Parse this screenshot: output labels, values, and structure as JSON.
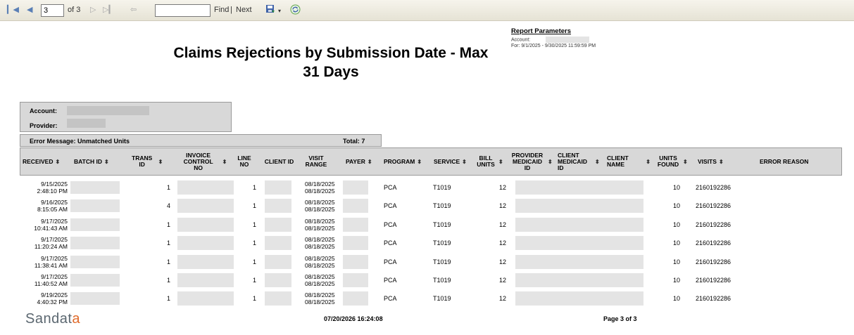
{
  "toolbar": {
    "page_value": "3",
    "of_pages": "of 3",
    "find_label": "Find",
    "separator": "|",
    "next_label": "Next",
    "icons": [
      "first-page-icon",
      "previous-page-icon",
      "next-page-icon",
      "last-page-icon",
      "back-icon",
      "export-icon",
      "dropdown-arrow-icon",
      "refresh-icon"
    ]
  },
  "report": {
    "title_line1": "Claims Rejections by Submission Date - Max",
    "title_line2": "31 Days"
  },
  "parameters": {
    "header": "Report Parameters",
    "account_label": "Account:",
    "for_text": "For: 9/1/2025 - 9/30/2025 11:59:59 PM"
  },
  "account_box": {
    "account_label": "Account:",
    "provider_label": "Provider:"
  },
  "error_group": {
    "message": "Error Message:  Unmatched Units",
    "total": "Total: 7"
  },
  "columns": [
    {
      "label": "RECEIVED",
      "sortable": true
    },
    {
      "label": "BATCH ID",
      "sortable": true
    },
    {
      "label": "TRANS ID",
      "sortable": true
    },
    {
      "label": "INVOICE CONTROL NO",
      "sortable": true
    },
    {
      "label": "LINE NO",
      "sortable": false
    },
    {
      "label": "CLIENT ID",
      "sortable": false
    },
    {
      "label": "VISIT RANGE",
      "sortable": false
    },
    {
      "label": "PAYER",
      "sortable": true
    },
    {
      "label": "PROGRAM",
      "sortable": true
    },
    {
      "label": "SERVICE",
      "sortable": true
    },
    {
      "label": "BILL UNITS",
      "sortable": true
    },
    {
      "label": "PROVIDER MEDICAID ID",
      "sortable": true
    },
    {
      "label": "CLIENT MEDICAID ID",
      "sortable": true
    },
    {
      "label": "CLIENT NAME",
      "sortable": true
    },
    {
      "label": "UNITS FOUND",
      "sortable": true
    },
    {
      "label": "VISITS",
      "sortable": true
    },
    {
      "label": "ERROR REASON",
      "sortable": false
    }
  ],
  "rows": [
    {
      "received_date": "9/15/2025",
      "received_time": "2:48:10 PM",
      "trans_id": "1",
      "line_no": "1",
      "visit_from": "08/18/2025",
      "visit_to": "08/18/2025",
      "program": "PCA",
      "service": "T1019",
      "bill_units": "12",
      "units_found": "10",
      "visits": "2160192286"
    },
    {
      "received_date": "9/16/2025",
      "received_time": "8:15:05 AM",
      "trans_id": "4",
      "line_no": "1",
      "visit_from": "08/18/2025",
      "visit_to": "08/18/2025",
      "program": "PCA",
      "service": "T1019",
      "bill_units": "12",
      "units_found": "10",
      "visits": "2160192286"
    },
    {
      "received_date": "9/17/2025",
      "received_time": "10:41:43 AM",
      "trans_id": "1",
      "line_no": "1",
      "visit_from": "08/18/2025",
      "visit_to": "08/18/2025",
      "program": "PCA",
      "service": "T1019",
      "bill_units": "12",
      "units_found": "10",
      "visits": "2160192286"
    },
    {
      "received_date": "9/17/2025",
      "received_time": "11:20:24 AM",
      "trans_id": "1",
      "line_no": "1",
      "visit_from": "08/18/2025",
      "visit_to": "08/18/2025",
      "program": "PCA",
      "service": "T1019",
      "bill_units": "12",
      "units_found": "10",
      "visits": "2160192286"
    },
    {
      "received_date": "9/17/2025",
      "received_time": "11:38:41 AM",
      "trans_id": "1",
      "line_no": "1",
      "visit_from": "08/18/2025",
      "visit_to": "08/18/2025",
      "program": "PCA",
      "service": "T1019",
      "bill_units": "12",
      "units_found": "10",
      "visits": "2160192286"
    },
    {
      "received_date": "9/17/2025",
      "received_time": "11:40:52 AM",
      "trans_id": "1",
      "line_no": "1",
      "visit_from": "08/18/2025",
      "visit_to": "08/18/2025",
      "program": "PCA",
      "service": "T1019",
      "bill_units": "12",
      "units_found": "10",
      "visits": "2160192286"
    },
    {
      "received_date": "9/19/2025",
      "received_time": "4:40:32 PM",
      "trans_id": "1",
      "line_no": "1",
      "visit_from": "08/18/2025",
      "visit_to": "08/18/2025",
      "program": "PCA",
      "service": "T1019",
      "bill_units": "12",
      "units_found": "10",
      "visits": "2160192286"
    }
  ],
  "footer": {
    "logo_text_main": "Sandat",
    "logo_text_accent": "a",
    "timestamp": "07/20/2026 16:24:08",
    "page_label": "Page 3 of 3"
  },
  "colors": {
    "header_bg": "#d8d8d8",
    "toolbar_icon": "#5a7fb5",
    "logo_gray": "#5b6770",
    "logo_accent": "#e06a2a"
  }
}
